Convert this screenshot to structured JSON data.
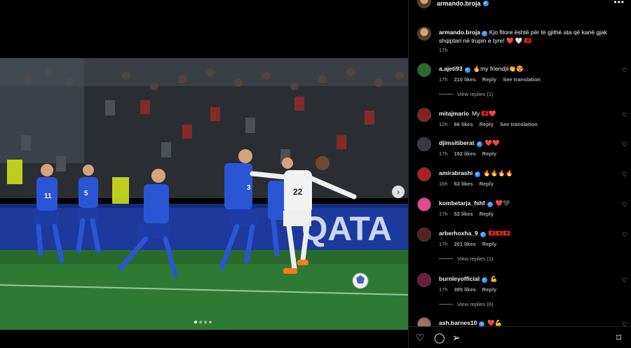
{
  "post": {
    "author": "armando.broja",
    "caption_text": "Kjo fitore është për të gjithë ata që kanë gjak shqiptari në trupin e tyre!",
    "caption_emojis": "❤️ 🤍 🇦🇱",
    "caption_time": "17h",
    "more_label": "•••"
  },
  "comments": [
    {
      "user": "a.ajeti93",
      "verified": true,
      "text": "🔥my friendjii👏😍",
      "time": "17h",
      "likes": "210 likes",
      "reply": "Reply",
      "translate": "See translation",
      "replies": "View replies (1)",
      "avatar_color": "#2b6b2b"
    },
    {
      "user": "mitajmario",
      "verified": false,
      "text": "My 🇦🇱❤️",
      "time": "12h",
      "likes": "66 likes",
      "reply": "Reply",
      "translate": "See translation",
      "replies": "",
      "avatar_color": "#8a1f1f"
    },
    {
      "user": "djimsitiberat",
      "verified": true,
      "text": "❤️❤️",
      "time": "17h",
      "likes": "192 likes",
      "reply": "Reply",
      "translate": "",
      "replies": "",
      "avatar_color": "#333a44"
    },
    {
      "user": "amirabrashi",
      "verified": true,
      "text": "🔥🔥🔥🔥",
      "time": "16h",
      "likes": "63 likes",
      "reply": "Reply",
      "translate": "",
      "replies": "",
      "avatar_color": "#b51d1d"
    },
    {
      "user": "kombetarja_fshf",
      "verified": true,
      "text": "❤️🖤",
      "time": "17h",
      "likes": "52 likes",
      "reply": "Reply",
      "translate": "",
      "replies": "",
      "avatar_color": "#e64a8c"
    },
    {
      "user": "arberhoxha_9",
      "verified": true,
      "text": "🇦🇱🇦🇱🇦🇱",
      "time": "17h",
      "likes": "201 likes",
      "reply": "Reply",
      "translate": "",
      "replies": "View replies (1)",
      "avatar_color": "#5a2020"
    },
    {
      "user": "burnleyofficial",
      "verified": true,
      "text": "💪",
      "time": "17h",
      "likes": "395 likes",
      "reply": "Reply",
      "translate": "",
      "replies": "View replies (6)",
      "avatar_color": "#6b1e3a"
    },
    {
      "user": "ash.barnes10",
      "verified": true,
      "text": "❤️💪",
      "time": "",
      "likes": "",
      "reply": "",
      "translate": "",
      "replies": "",
      "avatar_color": "#a07060"
    }
  ],
  "actions": {
    "like_icon": "heart-icon",
    "comment_icon": "comment-icon",
    "share_icon": "share-icon",
    "save_icon": "bookmark-icon"
  },
  "carousel": {
    "total": 4,
    "active": 0
  },
  "photo": {
    "billboard_text": "QATA"
  }
}
